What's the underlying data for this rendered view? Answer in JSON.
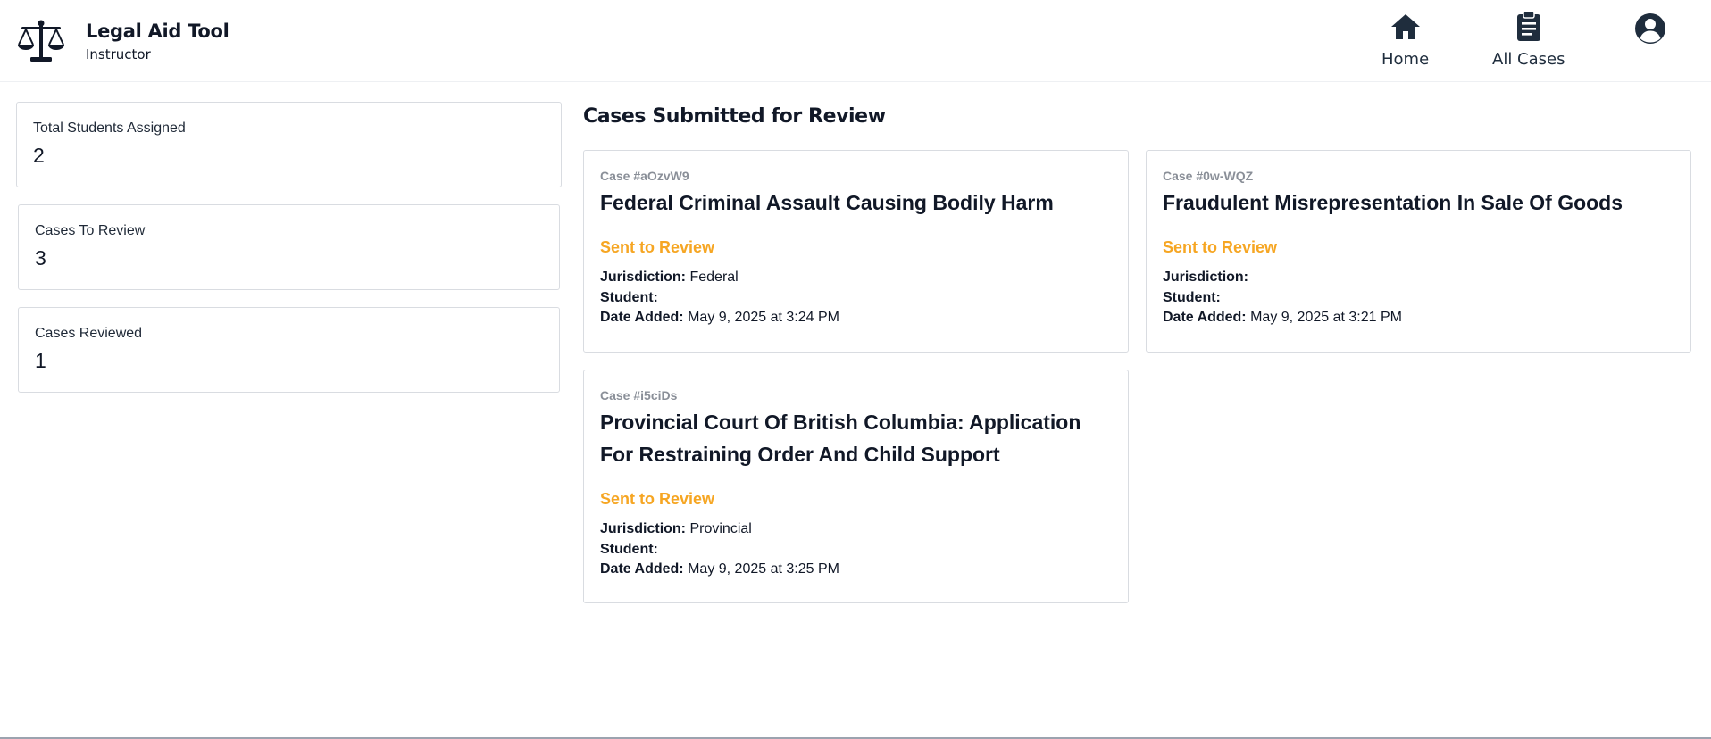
{
  "brand": {
    "title": "Legal Aid Tool",
    "subtitle": "Instructor",
    "icon": "scales-icon"
  },
  "nav": [
    {
      "label": "Home",
      "icon": "home-icon"
    },
    {
      "label": "All Cases",
      "icon": "clipboard-icon"
    }
  ],
  "profile": {
    "icon": "user-circle-icon"
  },
  "stats": [
    {
      "label": "Total Students Assigned",
      "value": "2"
    },
    {
      "label": "Cases To Review",
      "value": "3"
    },
    {
      "label": "Cases Reviewed",
      "value": "1"
    }
  ],
  "section": {
    "title": "Cases Submitted for Review"
  },
  "meta_labels": {
    "jurisdiction": "Jurisdiction:",
    "student": "Student:",
    "date_added": "Date Added:"
  },
  "cases": [
    {
      "id": "Case #aOzvW9",
      "title": "Federal Criminal Assault Causing Bodily Harm",
      "status": "Sent to Review",
      "jurisdiction": "Federal",
      "student": "",
      "date_added": "May 9, 2025 at 3:24 PM"
    },
    {
      "id": "Case #0w-WQZ",
      "title": "Fraudulent Misrepresentation In Sale Of Goods",
      "status": "Sent to Review",
      "jurisdiction": "",
      "student": "",
      "date_added": "May 9, 2025 at 3:21 PM"
    },
    {
      "id": "Case #i5ciDs",
      "title": "Provincial Court Of British Columbia: Application For Restraining Order And Child Support",
      "status": "Sent to Review",
      "jurisdiction": "Provincial",
      "student": "",
      "date_added": "May 9, 2025 at 3:25 PM"
    }
  ],
  "colors": {
    "accent_status": "#f6a623",
    "icon": "#1f2d3d",
    "border": "#d9dce1"
  }
}
